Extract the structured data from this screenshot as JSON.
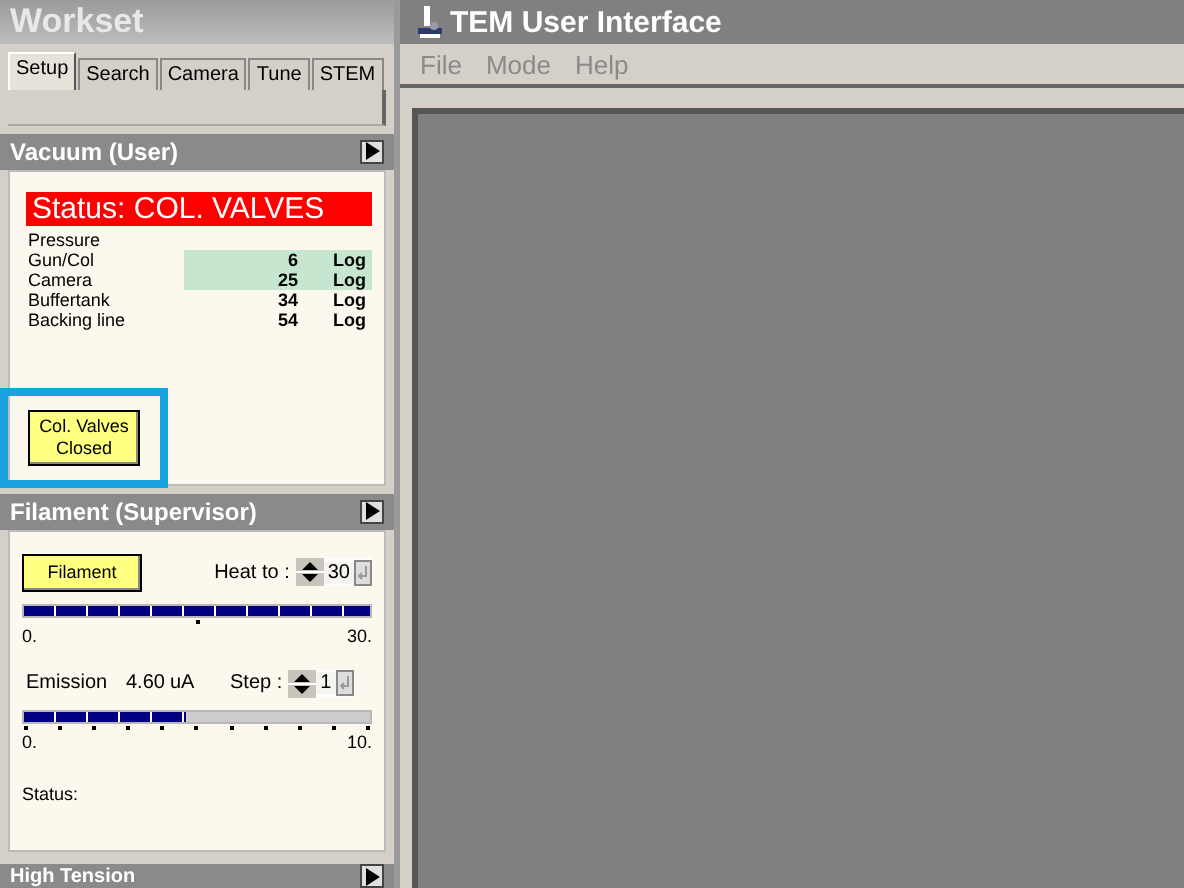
{
  "workset": {
    "title": "Workset",
    "tabs": [
      {
        "label": "Setup",
        "selected": true
      },
      {
        "label": "Search",
        "selected": false
      },
      {
        "label": "Camera",
        "selected": false
      },
      {
        "label": "Tune",
        "selected": false
      },
      {
        "label": "STEM",
        "selected": false
      }
    ]
  },
  "vacuum": {
    "title": "Vacuum (User)",
    "status": "Status:  COL. VALVES",
    "pressure_label": "Pressure",
    "rows": [
      {
        "name": "Gun/Col",
        "value": "6",
        "unit": "Log",
        "highlighted": true
      },
      {
        "name": "Camera",
        "value": "25",
        "unit": "Log",
        "highlighted": true
      },
      {
        "name": "Buffertank",
        "value": "34",
        "unit": "Log",
        "highlighted": false
      },
      {
        "name": "Backing line",
        "value": "54",
        "unit": "Log",
        "highlighted": false
      }
    ],
    "valves_button": {
      "lines": [
        "Col. Valves",
        "Closed"
      ],
      "highlighted": true
    }
  },
  "filament": {
    "title": "Filament (Supervisor)",
    "button": "Filament",
    "heat_label": "Heat to :",
    "heat_value": "30",
    "heat_bar": {
      "level": 1,
      "min": "0.",
      "max": "30."
    },
    "emission_label": "Emission",
    "emission_value": "4.60",
    "emission_unit": "uA",
    "step_label": "Step :",
    "step_value": "1",
    "emission_bar": {
      "level": 0.47,
      "min": "0.",
      "max": "10."
    },
    "status_label": "Status:"
  },
  "high_tension": {
    "title": "High Tension"
  },
  "main_window": {
    "title": "TEM User Interface",
    "menu": [
      "File",
      "Mode",
      "Help"
    ]
  }
}
